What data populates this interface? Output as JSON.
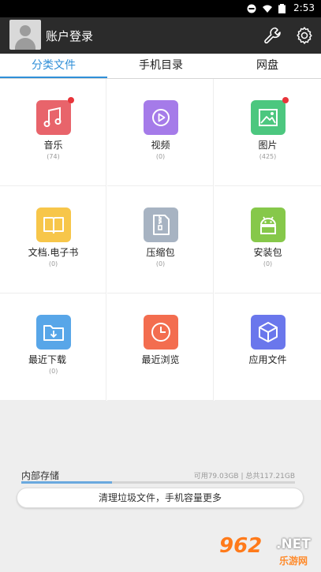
{
  "status_bar": {
    "time": "2:53"
  },
  "app_bar": {
    "login_label": "账户登录",
    "icons": [
      "wrench-icon",
      "gear-icon"
    ]
  },
  "tabs": [
    {
      "label": "分类文件",
      "selected": true
    },
    {
      "label": "手机目录",
      "selected": false
    },
    {
      "label": "网盘",
      "selected": false
    }
  ],
  "categories": [
    {
      "label": "音乐",
      "count": "(74)",
      "icon": "music-icon",
      "color": "#e8646b",
      "badge": true
    },
    {
      "label": "视频",
      "count": "(0)",
      "icon": "video-icon",
      "color": "#a57be9",
      "badge": false
    },
    {
      "label": "图片",
      "count": "(425)",
      "icon": "image-icon",
      "color": "#4cc77f",
      "badge": true
    },
    {
      "label": "文档.电子书",
      "count": "(0)",
      "icon": "book-icon",
      "color": "#f7c64a",
      "badge": false
    },
    {
      "label": "压缩包",
      "count": "(0)",
      "icon": "zip-icon",
      "color": "#a7b3c2",
      "badge": false
    },
    {
      "label": "安装包",
      "count": "(0)",
      "icon": "android-icon",
      "color": "#86c84a",
      "badge": false
    },
    {
      "label": "最近下载",
      "count": "(0)",
      "icon": "download-folder-icon",
      "color": "#58a6e8",
      "badge": false
    },
    {
      "label": "最近浏览",
      "count": "",
      "icon": "clock-icon",
      "color": "#f36d4f",
      "badge": false
    },
    {
      "label": "应用文件",
      "count": "",
      "icon": "cube-icon",
      "color": "#6a77ec",
      "badge": false
    }
  ],
  "storage": {
    "title": "内部存储",
    "info": "可用79.03GB | 总共117.21GB",
    "used_fraction": 0.33,
    "clean_button": "清理垃圾文件，手机容量更多"
  },
  "watermark": {
    "number": "962",
    "suffix": ".NET",
    "site": "乐游网"
  }
}
